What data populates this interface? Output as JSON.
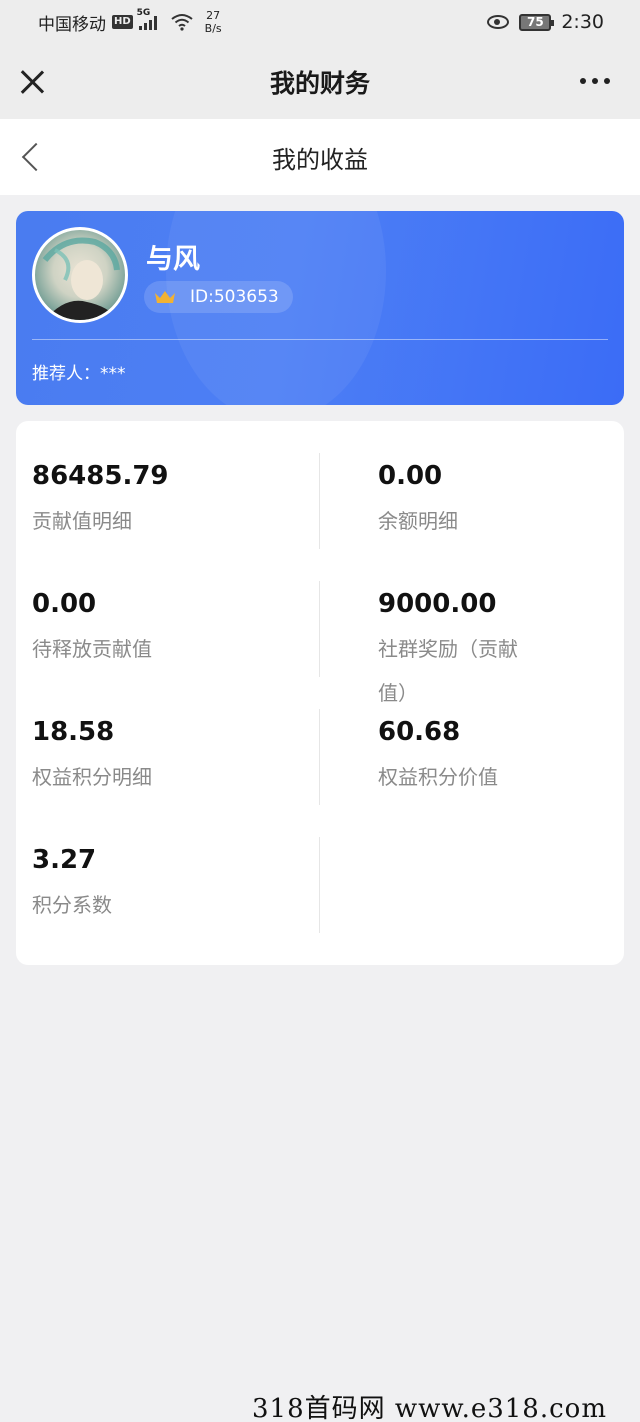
{
  "status_bar": {
    "carrier": "中国移动",
    "hd": "HD",
    "signal_label": "5G",
    "speed_top": "27",
    "speed_bottom": "B/s",
    "battery": "75",
    "time": "2:30"
  },
  "nav": {
    "title": "我的财务"
  },
  "page": {
    "title": "我的收益"
  },
  "profile": {
    "name": "与风",
    "id_text": "ID:503653",
    "referrer": "推荐人：***"
  },
  "stats": [
    {
      "value": "86485.79",
      "label": "贡献值明细"
    },
    {
      "value": "0.00",
      "label": "余额明细"
    },
    {
      "value": "0.00",
      "label": "待释放贡献值"
    },
    {
      "value": "9000.00",
      "label": "社群奖励（贡献值）"
    },
    {
      "value": "18.58",
      "label": "权益积分明细"
    },
    {
      "value": "60.68",
      "label": "权益积分价值"
    },
    {
      "value": "3.27",
      "label": "积分系数"
    }
  ],
  "stats_extra": {
    "label_line1": "社群奖励（贡献",
    "label_line2": "值）"
  },
  "watermark": "318首码网  www.e318.com",
  "colors": {
    "card_blue": "#4a7cf0",
    "page_bg": "#f0f0f2",
    "crown": "#f2b233"
  }
}
